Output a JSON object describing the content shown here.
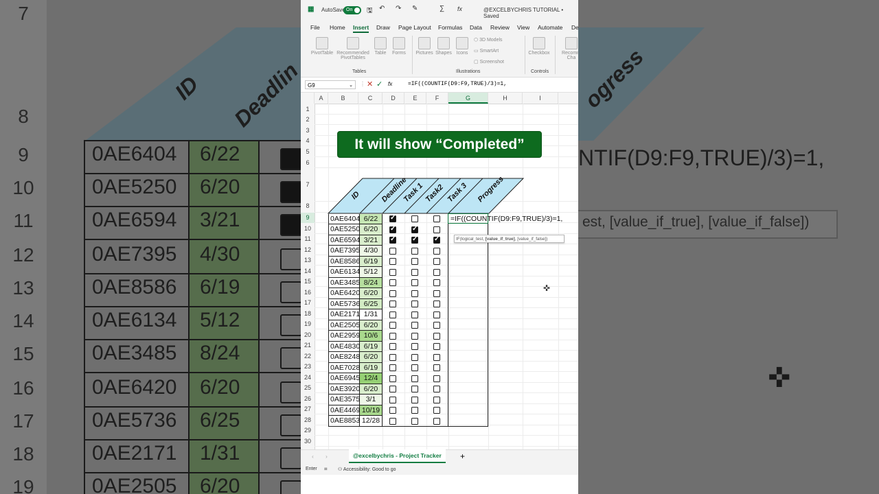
{
  "app": {
    "autosave_label": "AutoSave",
    "autosave_state": "On",
    "file_title": "@EXCELBYCHRIS TUTORIAL • Saved",
    "brand_color": "#107c41"
  },
  "tabs": [
    "File",
    "Home",
    "Insert",
    "Draw",
    "Page Layout",
    "Formulas",
    "Data",
    "Review",
    "View",
    "Automate",
    "De"
  ],
  "active_tab": "Insert",
  "ribbon": {
    "tables": {
      "label": "Tables",
      "items": [
        "PivotTable",
        "Recommended PivotTables",
        "Table",
        "Forms"
      ]
    },
    "illustrations": {
      "label": "Illustrations",
      "items": [
        "Pictures",
        "Shapes",
        "Icons",
        "3D Models",
        "SmartArt",
        "Screenshot"
      ]
    },
    "controls": {
      "label": "Controls",
      "items": [
        "Checkbox"
      ]
    },
    "more": "Recomm Cha"
  },
  "formula_bar": {
    "name_box": "G9",
    "fx": "fx",
    "formula": "=IF((COUNTIF(D9:F9,TRUE)/3)=1,"
  },
  "columns": [
    "A",
    "B",
    "C",
    "D",
    "E",
    "F",
    "G",
    "H",
    "I"
  ],
  "selected_column": "G",
  "selected_row": "9",
  "row_numbers": [
    "1",
    "2",
    "3",
    "4",
    "5",
    "6",
    "7",
    "8",
    "9",
    "10",
    "11",
    "12",
    "13",
    "14",
    "15",
    "16",
    "17",
    "18",
    "19",
    "20",
    "21",
    "22",
    "23",
    "24",
    "25",
    "26",
    "27",
    "28",
    "29",
    "30"
  ],
  "table_headers": [
    "ID",
    "Deadline",
    "Task 1",
    "Task2",
    "Task 3",
    "Progress"
  ],
  "header_color": "#bde5f5",
  "rows": [
    {
      "id": "0AE6404",
      "deadline": "6/22",
      "t1": true,
      "t2": false,
      "t3": false,
      "shade": "#c6e7b4"
    },
    {
      "id": "0AE5250",
      "deadline": "6/20",
      "t1": true,
      "t2": true,
      "t3": false,
      "shade": "#d9eecc"
    },
    {
      "id": "0AE6594",
      "deadline": "3/21",
      "t1": true,
      "t2": true,
      "t3": true,
      "shade": "#d9eecc"
    },
    {
      "id": "0AE7395",
      "deadline": "4/30",
      "t1": false,
      "t2": false,
      "t3": false,
      "shade": "#eef7e7"
    },
    {
      "id": "0AE8586",
      "deadline": "6/19",
      "t1": false,
      "t2": false,
      "t3": false,
      "shade": "#d9eecc"
    },
    {
      "id": "0AE6134",
      "deadline": "5/12",
      "t1": false,
      "t2": false,
      "t3": false,
      "shade": "#eef7e7"
    },
    {
      "id": "0AE3485",
      "deadline": "8/24",
      "t1": false,
      "t2": false,
      "t3": false,
      "shade": "#b6df9e"
    },
    {
      "id": "0AE6420",
      "deadline": "6/20",
      "t1": false,
      "t2": false,
      "t3": false,
      "shade": "#d9eecc"
    },
    {
      "id": "0AE5736",
      "deadline": "6/25",
      "t1": false,
      "t2": false,
      "t3": false,
      "shade": "#d2ebc3"
    },
    {
      "id": "0AE2171",
      "deadline": "1/31",
      "t1": false,
      "t2": false,
      "t3": false,
      "shade": "#ffffff"
    },
    {
      "id": "0AE2505",
      "deadline": "6/20",
      "t1": false,
      "t2": false,
      "t3": false,
      "shade": "#d9eecc"
    },
    {
      "id": "0AE2959",
      "deadline": "10/6",
      "t1": false,
      "t2": false,
      "t3": false,
      "shade": "#a9d98d"
    },
    {
      "id": "0AE4830",
      "deadline": "6/19",
      "t1": false,
      "t2": false,
      "t3": false,
      "shade": "#d9eecc"
    },
    {
      "id": "0AE8248",
      "deadline": "6/20",
      "t1": false,
      "t2": false,
      "t3": false,
      "shade": "#d9eecc"
    },
    {
      "id": "0AE7028",
      "deadline": "6/19",
      "t1": false,
      "t2": false,
      "t3": false,
      "shade": "#d9eecc"
    },
    {
      "id": "0AE6945",
      "deadline": "12/4",
      "t1": false,
      "t2": false,
      "t3": false,
      "shade": "#95d074"
    },
    {
      "id": "0AE3920",
      "deadline": "6/20",
      "t1": false,
      "t2": false,
      "t3": false,
      "shade": "#d9eecc"
    },
    {
      "id": "0AE3575",
      "deadline": "3/1",
      "t1": false,
      "t2": false,
      "t3": false,
      "shade": "#eef7e7"
    },
    {
      "id": "0AE4469",
      "deadline": "10/19",
      "t1": false,
      "t2": false,
      "t3": false,
      "shade": "#a9d98d"
    },
    {
      "id": "0AE8853",
      "deadline": "12/28",
      "t1": false,
      "t2": false,
      "t3": false,
      "shade": "#ffffff"
    }
  ],
  "cell_edit": "=IF((COUNTIF(D9:F9,TRUE)/3)=1,",
  "tooltip": {
    "fn": "IF(logical_test, ",
    "bold": "[value_if_true]",
    "rest": ", [value_if_false])"
  },
  "banner": "It will show “Completed”",
  "sheet_tab": "@excelbychris - Project Tracker",
  "status": {
    "mode": "Enter",
    "accessibility": "Accessibility: Good to go"
  },
  "background": {
    "rows": [
      "7",
      "8",
      "9",
      "10",
      "11",
      "12",
      "13",
      "14",
      "15",
      "16",
      "17",
      "18",
      "19"
    ],
    "headers": [
      "ID",
      "Deadlin",
      "ogress"
    ],
    "formula_fragment": "NTIF(D9:F9,TRUE)/3)=1,",
    "tooltip_fragment": "est, [value_if_true], [value_if_false])"
  }
}
